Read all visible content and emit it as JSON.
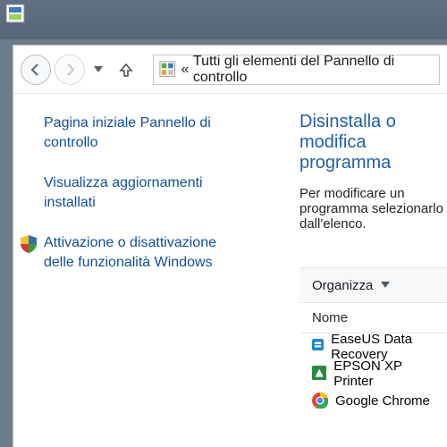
{
  "taskbar": {
    "icon": "app-icon"
  },
  "nav": {
    "breadcrumb_prefix": "«",
    "breadcrumb": "Tutti gli elementi del Pannello di controllo"
  },
  "sidebar": {
    "links": [
      {
        "label": "Pagina iniziale Pannello di controllo",
        "shield": false
      },
      {
        "label": "Visualizza aggiornamenti installati",
        "shield": false
      },
      {
        "label": "Attivazione o disattivazione delle funzionalità Windows",
        "shield": true
      }
    ]
  },
  "main": {
    "heading": "Disinstalla o modifica programma",
    "description": "Per modificare un programma selezionarlo dall'elenco.",
    "toolbar": {
      "organize": "Organizza"
    },
    "column_header": "Nome",
    "items": [
      {
        "name": "EaseUS Data Recovery",
        "icon": "easeus"
      },
      {
        "name": "EPSON XP Printer",
        "icon": "epson"
      },
      {
        "name": "Google Chrome",
        "icon": "chrome"
      }
    ]
  }
}
